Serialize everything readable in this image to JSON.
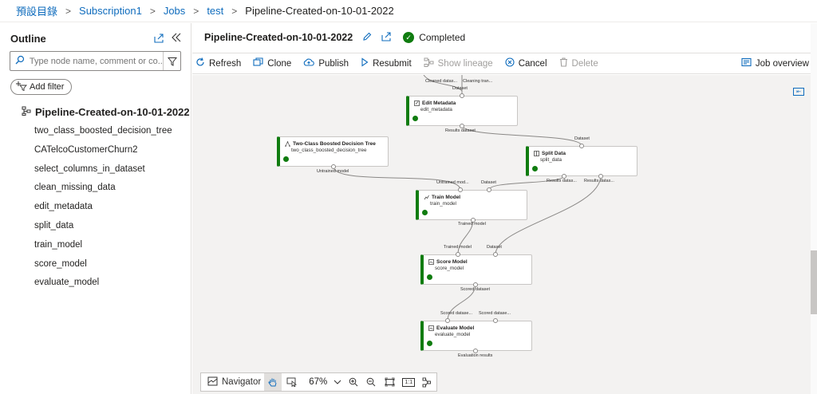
{
  "breadcrumb": {
    "items": [
      "預設目錄",
      "Subscription1",
      "Jobs",
      "test"
    ],
    "current": "Pipeline-Created-on-10-01-2022"
  },
  "sidebar": {
    "title": "Outline",
    "search_placeholder": "Type node name, comment or co...",
    "add_filter": "Add filter",
    "root": "Pipeline-Created-on-10-01-2022",
    "items": [
      "two_class_boosted_decision_tree",
      "CATelcoCustomerChurn2",
      "select_columns_in_dataset",
      "clean_missing_data",
      "edit_metadata",
      "split_data",
      "train_model",
      "score_model",
      "evaluate_model"
    ]
  },
  "header": {
    "title": "Pipeline-Created-on-10-01-2022",
    "status": "Completed"
  },
  "toolbar": {
    "refresh": "Refresh",
    "clone": "Clone",
    "publish": "Publish",
    "resubmit": "Resubmit",
    "show_lineage": "Show lineage",
    "cancel": "Cancel",
    "delete": "Delete",
    "job_overview": "Job overview"
  },
  "graph": {
    "top_labels": {
      "cleaned": "Cleaned datas...",
      "cleaning": "Cleaning tran..."
    },
    "edit_metadata": {
      "title": "Edit Metadata",
      "name": "edit_metadata",
      "in": "Dataset",
      "out": "Results dataset"
    },
    "boosted_tree": {
      "title": "Two-Class Boosted Decision Tree",
      "name": "two_class_boosted_decision_tree",
      "out": "Untrained model"
    },
    "split_data": {
      "title": "Split Data",
      "name": "split_data",
      "in": "Dataset",
      "out1": "Results datas...",
      "out2": "Results datas..."
    },
    "train_model": {
      "title": "Train Model",
      "name": "train_model",
      "in1": "Untrained mod...",
      "in2": "Dataset",
      "out": "Trained model"
    },
    "score_model": {
      "title": "Score Model",
      "name": "score_model",
      "in1": "Trained model",
      "in2": "Dataset",
      "out": "Scored dataset"
    },
    "evaluate_model": {
      "title": "Evaluate Model",
      "name": "evaluate_model",
      "in1": "Scored datase...",
      "in2": "Scored datase...",
      "out": "Evaluation results"
    }
  },
  "navigator": {
    "label": "Navigator",
    "zoom": "67%",
    "fit_label": "1:1"
  },
  "colors": {
    "accent": "#0f6cbd",
    "success": "#107c10",
    "canvas": "#f3f2f1"
  }
}
